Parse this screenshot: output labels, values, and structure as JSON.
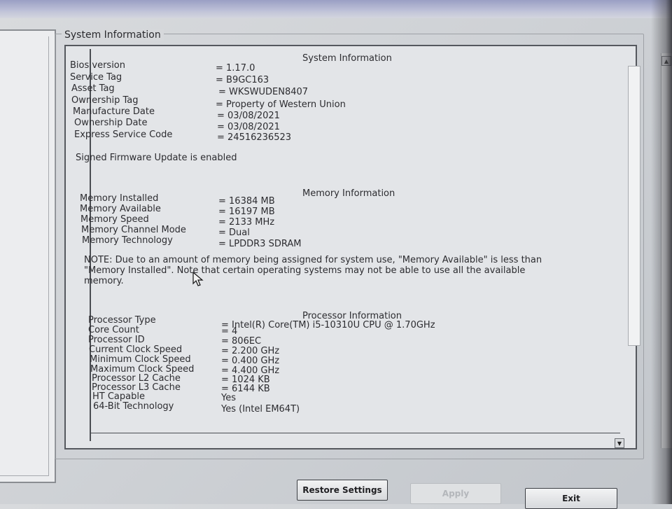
{
  "group_title": "System Information",
  "system": {
    "heading": "System Information",
    "rows": [
      {
        "key": "Bios version",
        "value": "= 1.17.0"
      },
      {
        "key": "Service Tag",
        "value": "= B9GC163"
      },
      {
        "key": "Asset Tag",
        "value": "= WKSWUDEN8407"
      },
      {
        "key": "Ownership Tag",
        "value": "= Property of Western Union"
      },
      {
        "key": "Manufacture Date",
        "value": "= 03/08/2021"
      },
      {
        "key": "Ownership Date",
        "value": "= 03/08/2021"
      },
      {
        "key": "Express Service Code",
        "value": "= 24516236523"
      }
    ],
    "firmware_line": "Signed Firmware Update is enabled"
  },
  "memory": {
    "heading": "Memory Information",
    "rows": [
      {
        "key": "Memory Installed",
        "value": "= 16384 MB"
      },
      {
        "key": "Memory Available",
        "value": "= 16197 MB"
      },
      {
        "key": "Memory Speed",
        "value": "= 2133 MHz"
      },
      {
        "key": "Memory Channel Mode",
        "value": "= Dual"
      },
      {
        "key": "Memory Technology",
        "value": "= LPDDR3 SDRAM"
      }
    ],
    "note": "NOTE: Due to an amount of memory being assigned for system use, \"Memory Available\" is less than \"Memory Installed\". Note that certain operating systems may not be able to use all the available memory."
  },
  "processor": {
    "heading": "Processor Information",
    "rows": [
      {
        "key": "Processor Type",
        "value": "= Intel(R) Core(TM) i5-10310U CPU @ 1.70GHz"
      },
      {
        "key": "Core Count",
        "value": "= 4"
      },
      {
        "key": "Processor ID",
        "value": "= 806EC"
      },
      {
        "key": "Current Clock Speed",
        "value": "= 2.200 GHz"
      },
      {
        "key": "Minimum Clock Speed",
        "value": "= 0.400 GHz"
      },
      {
        "key": "Maximum Clock Speed",
        "value": "= 4.400 GHz"
      },
      {
        "key": "Processor L2 Cache",
        "value": "= 1024 KB"
      },
      {
        "key": "Processor L3 Cache",
        "value": "= 6144 KB"
      },
      {
        "key": "HT Capable",
        "value": "Yes"
      },
      {
        "key": "64-Bit Technology",
        "value": "Yes (Intel EM64T)"
      }
    ]
  },
  "buttons": {
    "restore": "Restore Settings",
    "apply": "Apply",
    "exit": "Exit"
  },
  "icons": {
    "scroll_up": "triangle-up-icon",
    "scroll_down": "triangle-down-icon",
    "cursor": "pointer-cursor-icon"
  }
}
